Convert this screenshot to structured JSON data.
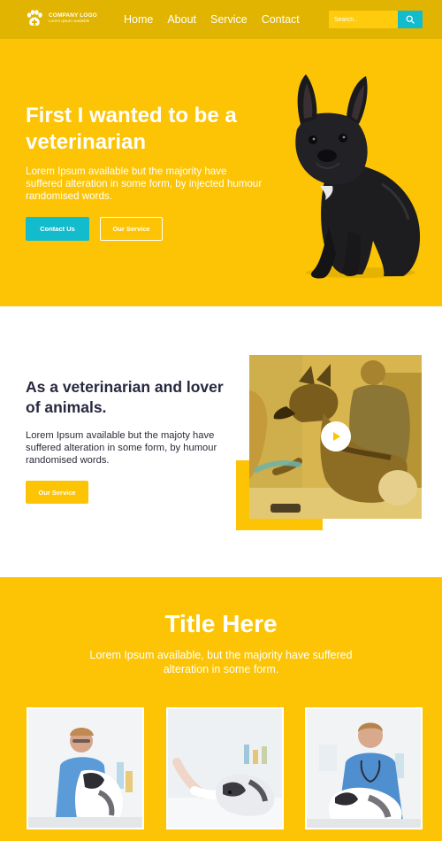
{
  "header": {
    "logo_name": "COMPANY LOGO",
    "logo_tagline": "Lorem Ipsum available",
    "nav": [
      "Home",
      "About",
      "Service",
      "Contact"
    ],
    "search_placeholder": "Search.."
  },
  "hero": {
    "title": "First I wanted to be a veterinarian",
    "text": "Lorem Ipsum available but the majority have suffered alteration in some form, by injected humour randomised words.",
    "primary_button": "Contact Us",
    "secondary_button": "Our Service"
  },
  "about": {
    "title": "As a veterinarian and lover of animals.",
    "text": "Lorem Ipsum available but the majoty have suffered alteration in some form, by humour randomised words.",
    "button": "Our Service"
  },
  "services": {
    "title": "Title Here",
    "subtitle": "Lorem Ipsum available, but the majority have suffered alteration in some form."
  },
  "colors": {
    "brand_yellow": "#fcc405",
    "header_yellow": "#e0b400",
    "accent_teal": "#13bccd",
    "heading_dark": "#282840"
  },
  "icons": {
    "logo": "paw-icon",
    "search": "search-icon",
    "video": "play-icon"
  }
}
